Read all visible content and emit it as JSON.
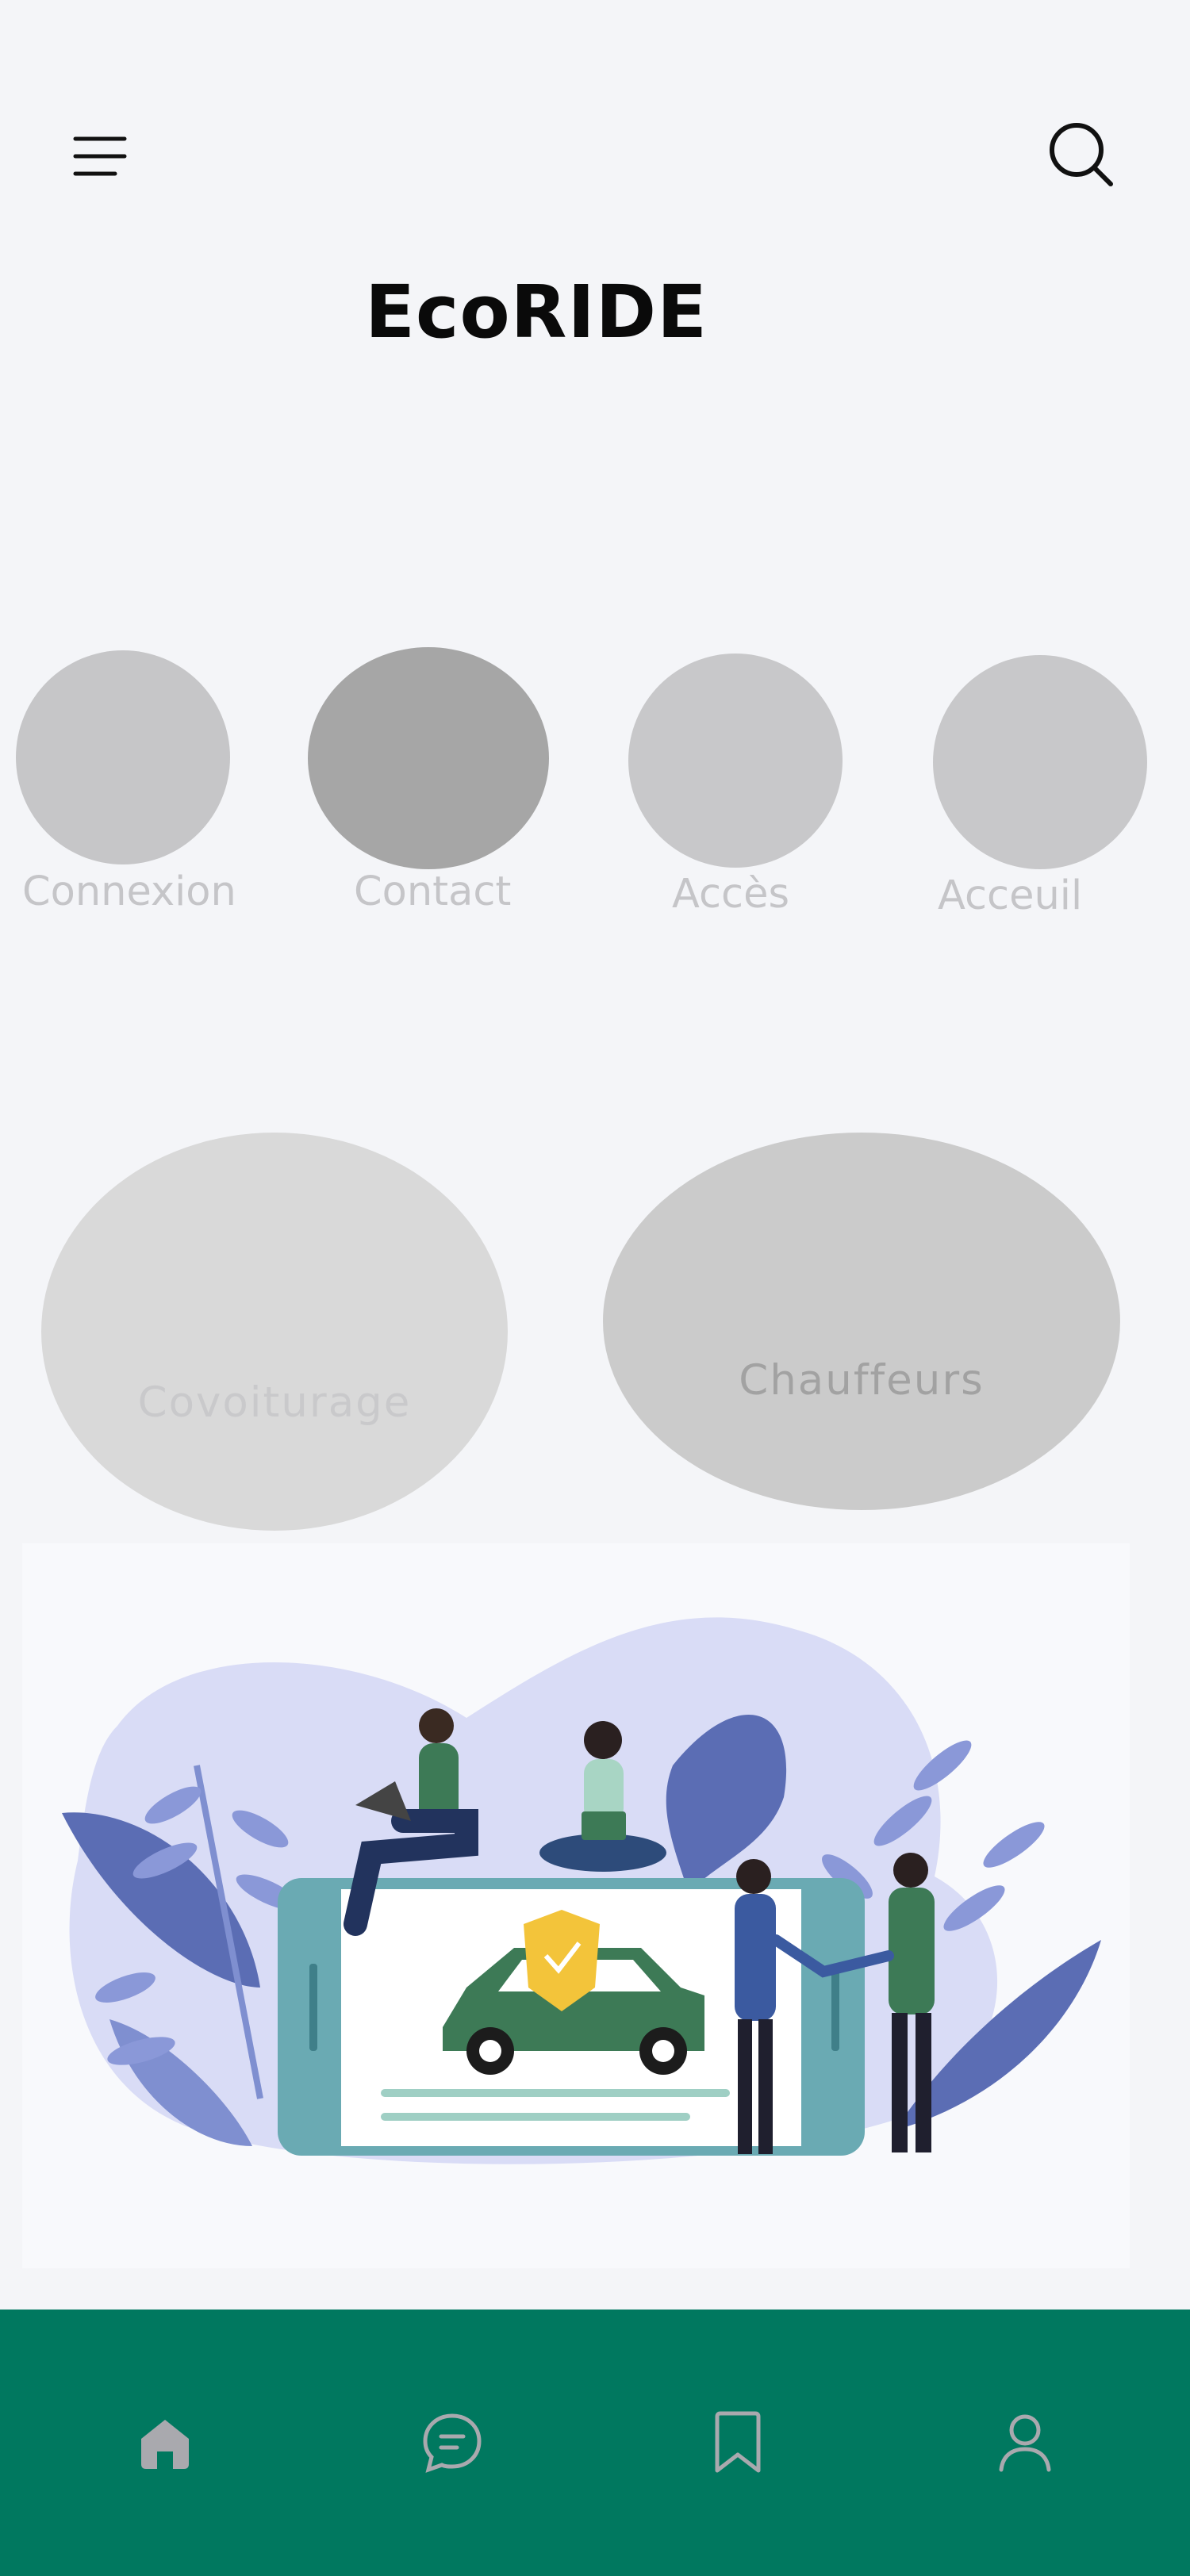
{
  "app": {
    "title": "EcoRIDE"
  },
  "header": {
    "menu_icon": "hamburger-menu-icon",
    "search_icon": "search-icon"
  },
  "quick_nav": [
    {
      "label": "Connexion",
      "color": "#c6c6c8"
    },
    {
      "label": "Contact",
      "color": "#a6a6a6"
    },
    {
      "label": "Accès",
      "color": "#c8c8ca"
    },
    {
      "label": "Acceuil",
      "color": "#c8c8ca"
    }
  ],
  "sections": [
    {
      "label": "Covoiturage",
      "color": "#d9d9d9",
      "text_color": "#c9c9cb"
    },
    {
      "label": "Chauffeurs",
      "color": "#cbcbcb",
      "text_color": "#a2a2a2"
    }
  ],
  "bottom_nav": {
    "background": "#00785f",
    "tabs": [
      {
        "icon": "home-icon",
        "active": true
      },
      {
        "icon": "chat-icon",
        "active": false
      },
      {
        "icon": "bookmark-icon",
        "active": false
      },
      {
        "icon": "profile-icon",
        "active": false
      }
    ]
  }
}
